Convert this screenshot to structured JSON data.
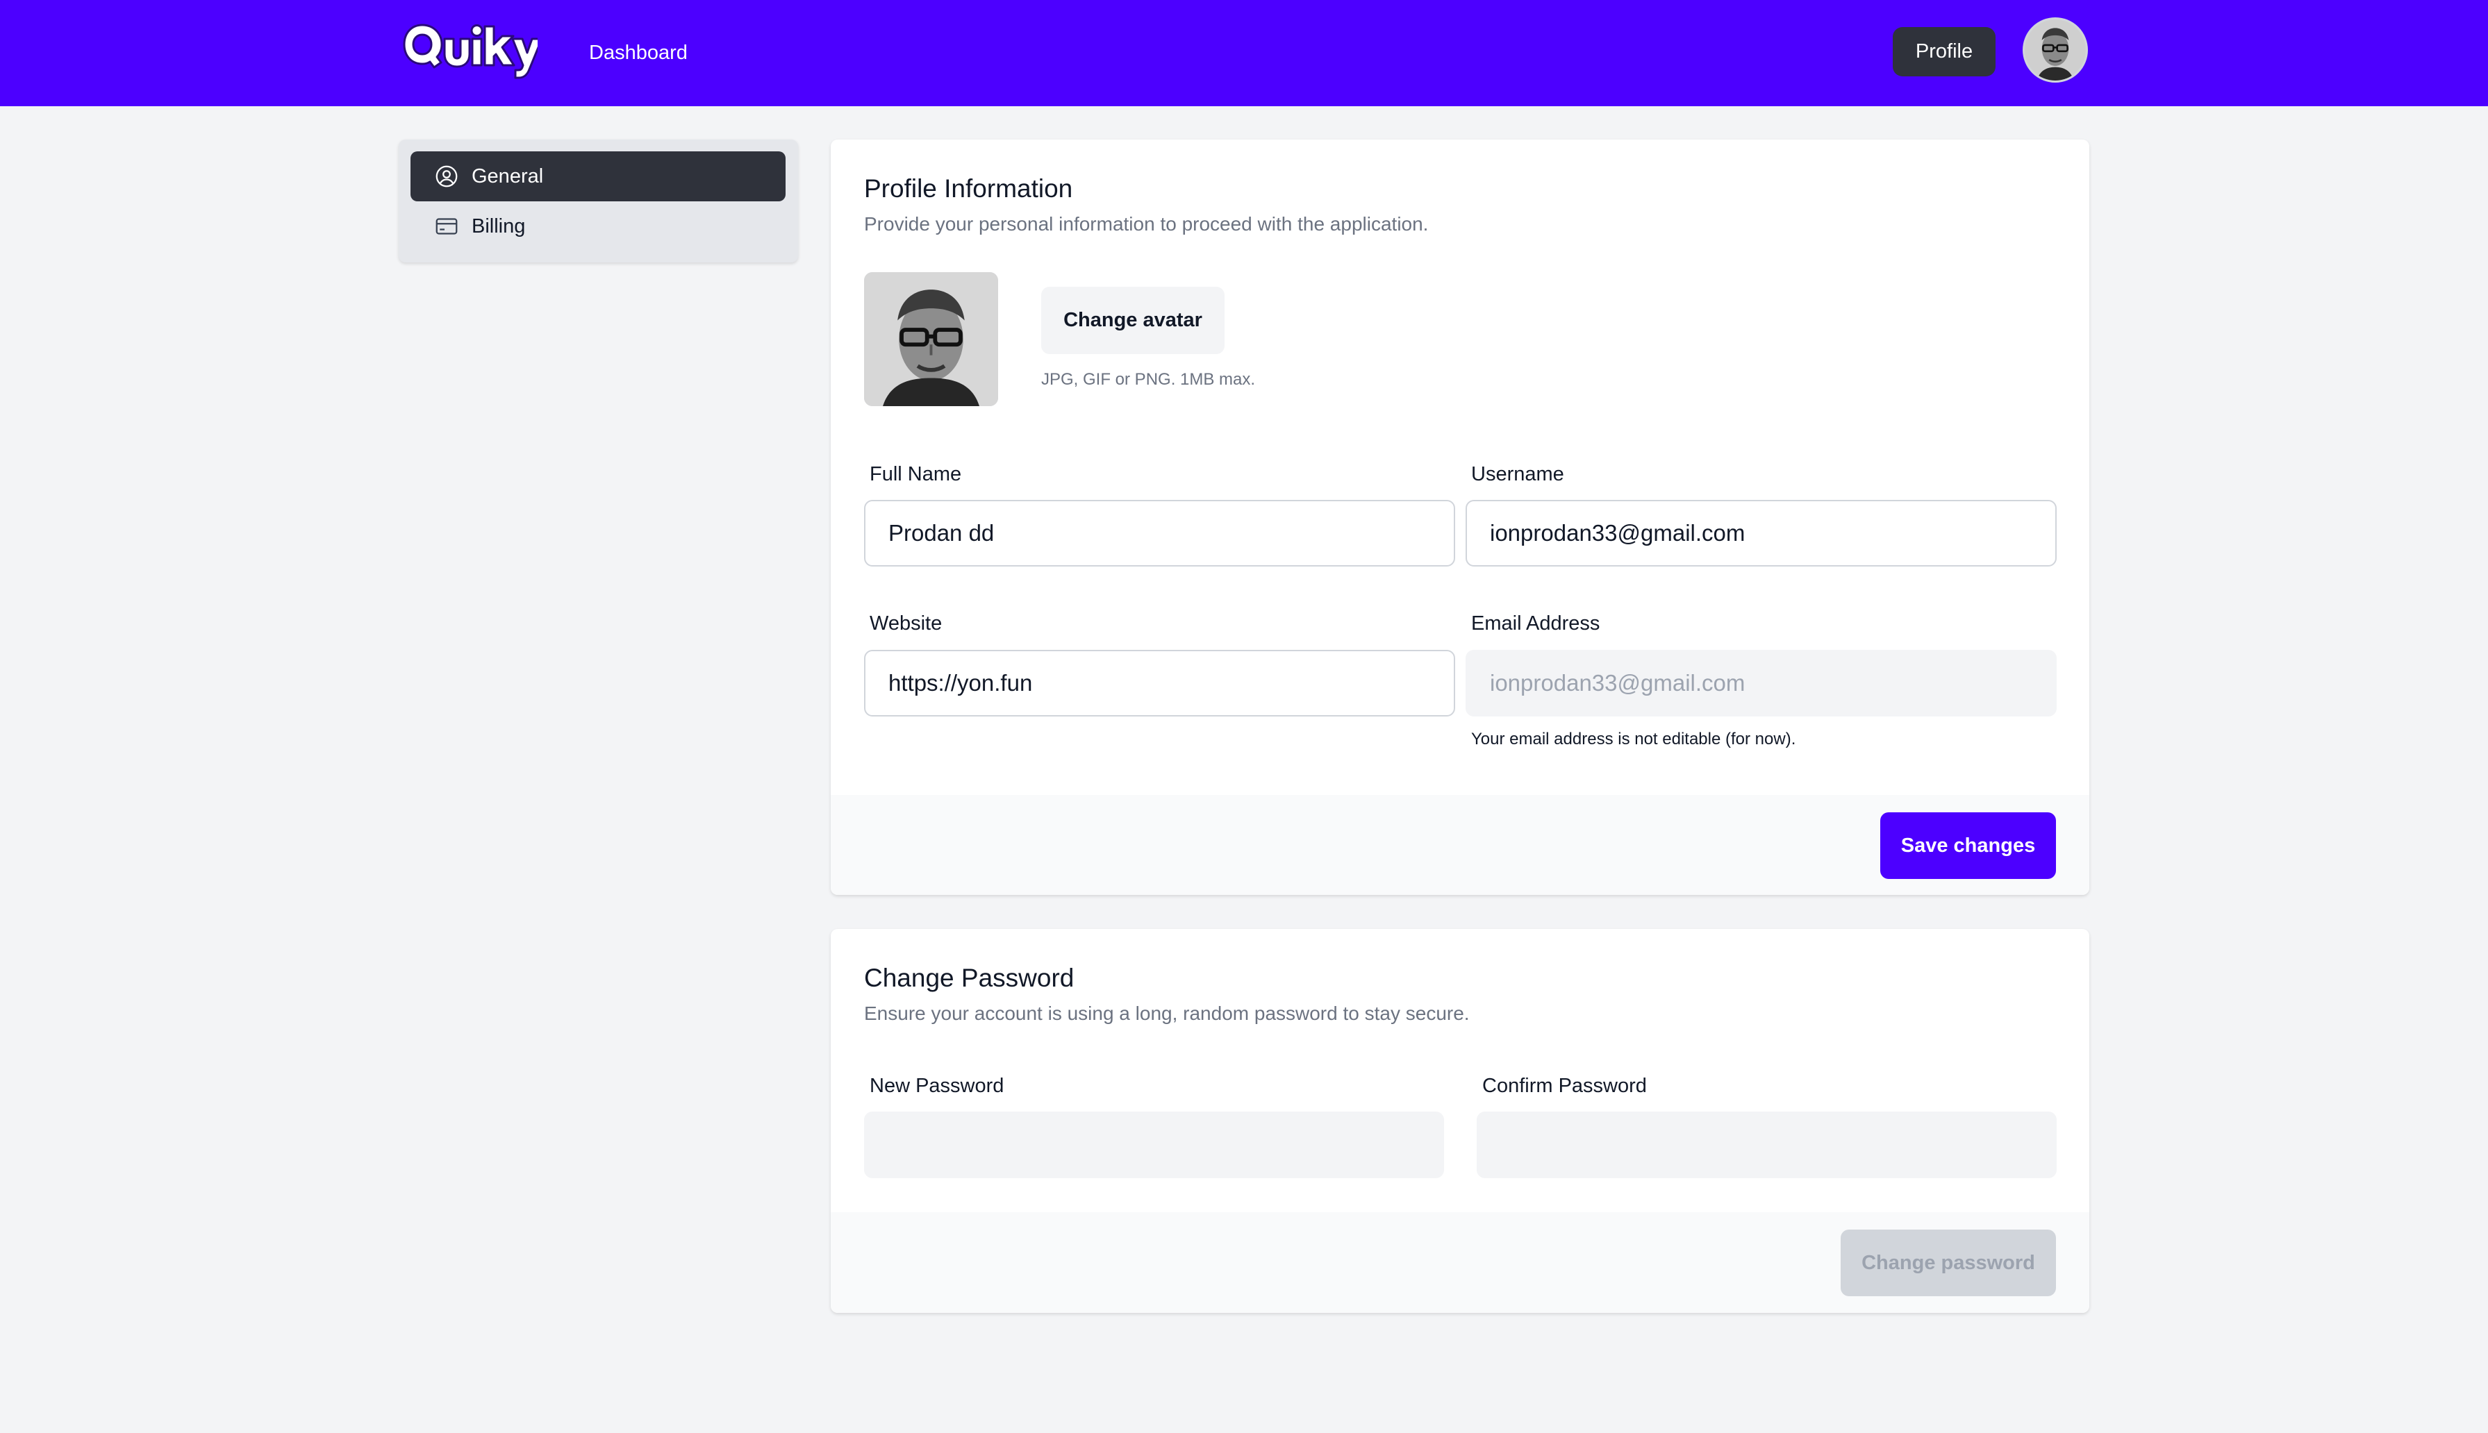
{
  "header": {
    "logo_text": "Quiky",
    "nav_dashboard": "Dashboard",
    "profile_label": "Profile"
  },
  "sidebar": {
    "items": [
      {
        "label": "General",
        "icon": "user-circle-icon",
        "active": true
      },
      {
        "label": "Billing",
        "icon": "credit-card-icon",
        "active": false
      }
    ]
  },
  "profile_card": {
    "title": "Profile Information",
    "subtitle": "Provide your personal information to proceed with the application.",
    "change_avatar_label": "Change avatar",
    "avatar_hint": "JPG, GIF or PNG. 1MB max.",
    "fields": {
      "full_name": {
        "label": "Full Name",
        "value": "Prodan dd"
      },
      "username": {
        "label": "Username",
        "value": "ionprodan33@gmail.com"
      },
      "website": {
        "label": "Website",
        "value": "https://yon.fun"
      },
      "email": {
        "label": "Email Address",
        "value": "ionprodan33@gmail.com",
        "note": "Your email address is not editable (for now)."
      }
    },
    "save_label": "Save changes"
  },
  "password_card": {
    "title": "Change Password",
    "subtitle": "Ensure your account is using a long, random password to stay secure.",
    "new_password_label": "New Password",
    "confirm_password_label": "Confirm Password",
    "submit_label": "Change password"
  },
  "colors": {
    "brand": "#4c00ff",
    "dark": "#2f323b",
    "background": "#f3f4f6"
  }
}
